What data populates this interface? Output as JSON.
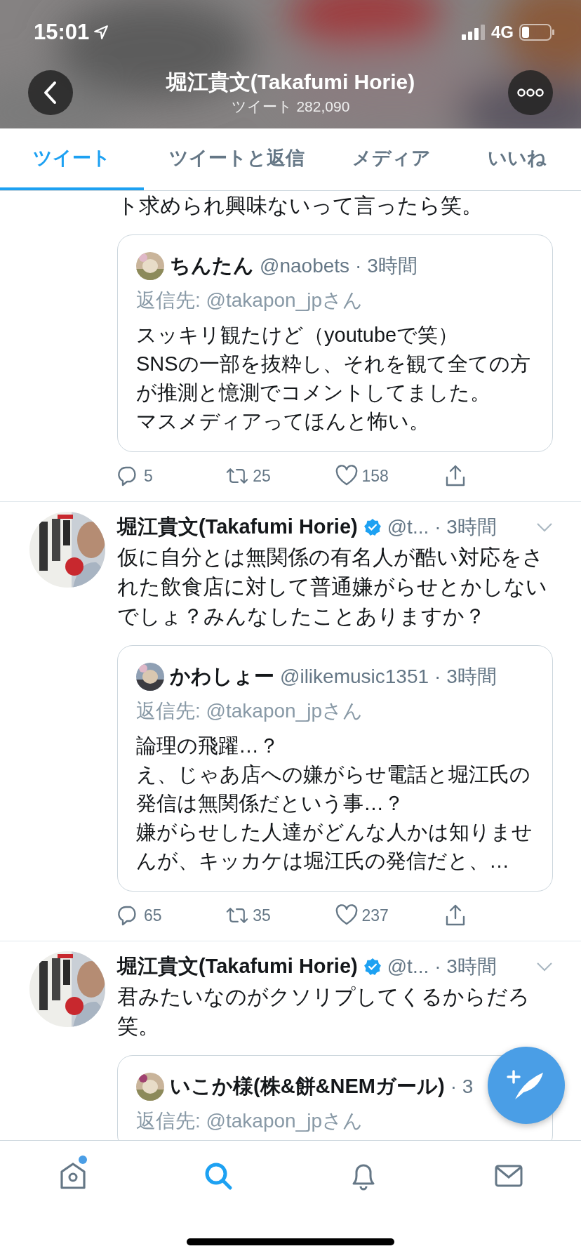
{
  "status_bar": {
    "time": "15:01",
    "network": "4G"
  },
  "header": {
    "title": "堀江貴文(Takafumi Horie)",
    "subtitle": "ツイート 282,090"
  },
  "tabs": [
    {
      "label": "ツイート",
      "selected": true
    },
    {
      "label": "ツイートと返信",
      "selected": false
    },
    {
      "label": "メディア",
      "selected": false
    },
    {
      "label": "いいね",
      "selected": false
    }
  ],
  "tweets": [
    {
      "text": "ト求められ興味ないって言ったら笑。",
      "quote": {
        "name": "ちんたん",
        "handle": "@naobets",
        "time": "· 3時間",
        "reply_to": "返信先: @takapon_jpさん",
        "lines": [
          "スッキリ観たけど（youtubeで笑）",
          "SNSの一部を抜粋し、それを観て全ての方が推測と憶測でコメントしてました。",
          "マスメディアってほんと怖い。"
        ]
      },
      "actions": [
        {
          "kind": "reply",
          "count": "5"
        },
        {
          "kind": "retweet",
          "count": "25"
        },
        {
          "kind": "like",
          "count": "158"
        },
        {
          "kind": "share"
        }
      ]
    },
    {
      "author": "堀江貴文(Takafumi Horie)",
      "verified": true,
      "handle": "@t...",
      "time": "· 3時間",
      "text": "仮に自分とは無関係の有名人が酷い対応をされた飲食店に対して普通嫌がらせとかしないでしょ？みんなしたことありますか？",
      "quote": {
        "name": "かわしょー",
        "handle": "@ilikemusic1351",
        "time": "· 3時間",
        "reply_to": "返信先: @takapon_jpさん",
        "lines": [
          "論理の飛躍…？",
          "え、じゃあ店への嫌がらせ電話と堀江氏の発信は無関係だという事…？",
          "嫌がらせした人達がどんな人かは知りませんが、キッカケは堀江氏の発信だと、…"
        ]
      },
      "actions": [
        {
          "kind": "reply",
          "count": "65"
        },
        {
          "kind": "retweet",
          "count": "35"
        },
        {
          "kind": "like",
          "count": "237"
        },
        {
          "kind": "share"
        }
      ]
    },
    {
      "author": "堀江貴文(Takafumi Horie)",
      "verified": true,
      "handle": "@t...",
      "time": "· 3時間",
      "text": "君みたいなのがクソリプしてくるからだろ笑。",
      "quote": {
        "name": "いこか様(株&餅&NEMガール)",
        "time": "· 3",
        "reply_to": "返信先: @takapon_jpさん"
      }
    }
  ],
  "bottom_nav": [
    {
      "kind": "home",
      "selected": false,
      "badge": true
    },
    {
      "kind": "search",
      "selected": true
    },
    {
      "kind": "notifications",
      "selected": false
    },
    {
      "kind": "messages",
      "selected": false
    }
  ]
}
